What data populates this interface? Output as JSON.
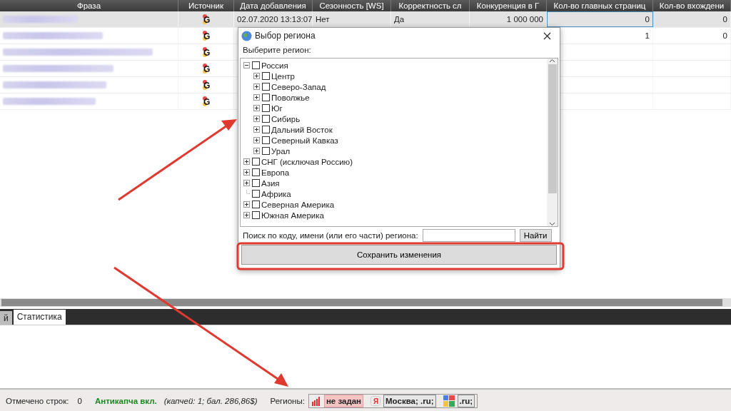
{
  "table": {
    "columns": [
      "Фраза",
      "Источник",
      "Дата добавления",
      "Сезонность [WS]",
      "Корректность сл",
      "Конкуренция в Г",
      "Кол-во главных страниц",
      "Кол-во вхождени"
    ],
    "rows": [
      {
        "selected": true,
        "source": "G",
        "date": "02.07.2020 13:13:07",
        "seasonality": "Нет",
        "correctness": "Да",
        "competition": "1 000 000",
        "main_pages": "0",
        "occurrences": "0"
      },
      {
        "selected": false,
        "source": "G",
        "main_pages": "1",
        "occurrences": "0"
      },
      {
        "selected": false,
        "source": "G"
      },
      {
        "selected": false,
        "source": "G"
      },
      {
        "selected": false,
        "source": "G"
      },
      {
        "selected": false,
        "source": "G"
      }
    ]
  },
  "dialog": {
    "title": "Выбор региона",
    "prompt": "Выберите регион:",
    "tree": [
      {
        "label": "Россия",
        "kind": "expanded",
        "checked": false,
        "children": [
          {
            "label": "Центр",
            "kind": "collapsed",
            "checked": false
          },
          {
            "label": "Северо-Запад",
            "kind": "collapsed",
            "checked": false
          },
          {
            "label": "Поволжье",
            "kind": "collapsed",
            "checked": false
          },
          {
            "label": "Юг",
            "kind": "collapsed",
            "checked": false
          },
          {
            "label": "Сибирь",
            "kind": "collapsed",
            "checked": false
          },
          {
            "label": "Дальний Восток",
            "kind": "collapsed",
            "checked": false
          },
          {
            "label": "Северный Кавказ",
            "kind": "collapsed",
            "checked": false
          },
          {
            "label": "Урал",
            "kind": "collapsed",
            "checked": false
          }
        ]
      },
      {
        "label": "СНГ (исключая Россию)",
        "kind": "collapsed",
        "checked": false
      },
      {
        "label": "Европа",
        "kind": "collapsed",
        "checked": false
      },
      {
        "label": "Азия",
        "kind": "collapsed",
        "checked": false
      },
      {
        "label": "Африка",
        "kind": "leaf",
        "checked": false
      },
      {
        "label": "Северная Америка",
        "kind": "collapsed",
        "checked": false
      },
      {
        "label": "Южная Америка",
        "kind": "collapsed",
        "checked": false
      }
    ],
    "search_label": "Поиск по коду, имени (или его части) региона:",
    "find_button": "Найти",
    "save_button": "Сохранить изменения"
  },
  "bottom_tabs": [
    {
      "label": "й",
      "selected": false
    },
    {
      "label": "Статистика",
      "selected": true
    }
  ],
  "status_bar": {
    "marked_label": "Отмечено строк:",
    "marked_count": "0",
    "anticaptcha": "Антикапча вкл.",
    "anticaptcha_details": "(капчей: 1; бал. 286,86$)",
    "regions_label": "Регионы:",
    "regions": [
      {
        "kind": "signal",
        "text": "не задан",
        "warning": true
      },
      {
        "kind": "letter",
        "icon_text": "Я",
        "text": "Москва; .ru;",
        "warning": false
      },
      {
        "kind": "blocks",
        "text": ".ru;",
        "warning": false
      }
    ]
  }
}
